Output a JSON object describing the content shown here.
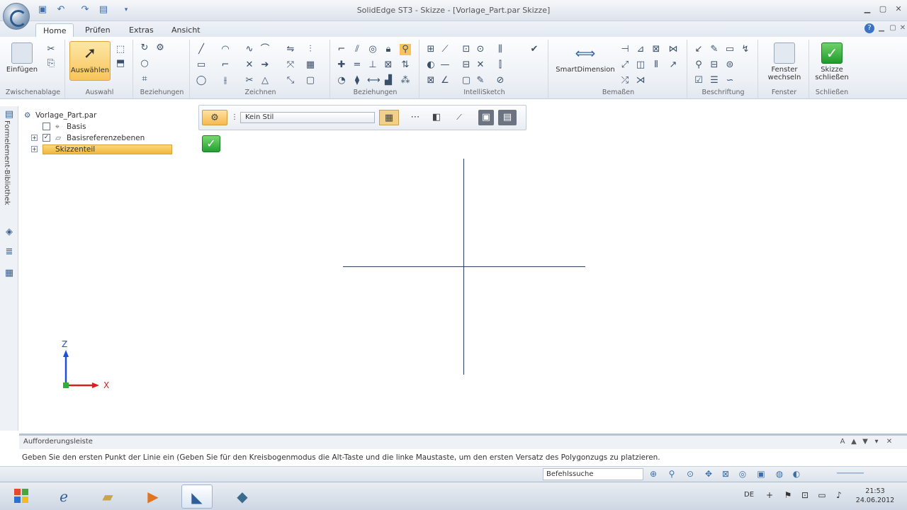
{
  "window": {
    "title": "SolidEdge ST3 - Skizze - [Vorlage_Part.par Skizze]"
  },
  "tabs": [
    {
      "label": "Home"
    },
    {
      "label": "Prüfen"
    },
    {
      "label": "Extras"
    },
    {
      "label": "Ansicht"
    }
  ],
  "ribbon": {
    "clipboard": {
      "paste_label": "Einfügen",
      "group_label": "Zwischenablage"
    },
    "select": {
      "select_label": "Auswählen",
      "group_label": "Auswahl"
    },
    "relate": {
      "group_label": "Beziehungen"
    },
    "draw": {
      "group_label": "Zeichnen"
    },
    "relationships": {
      "group_label": "Beziehungen"
    },
    "intellisketch": {
      "group_label": "IntelliSketch"
    },
    "dimension": {
      "smart_label": "SmartDimension",
      "group_label": "Bemaßen"
    },
    "annotate": {
      "group_label": "Beschriftung"
    },
    "window": {
      "switch_label": "Fenster wechseln",
      "group_label": "Fenster"
    },
    "close": {
      "close_label": "Skizze schließen",
      "group_label": "Schließen"
    }
  },
  "leftbar": {
    "label": "Formelement-Bibliothek"
  },
  "tree": {
    "items": [
      {
        "label": "Vorlage_Part.par"
      },
      {
        "label": "Basis"
      },
      {
        "label": "Basisreferenzebenen"
      },
      {
        "label": "Skizzenteil"
      }
    ]
  },
  "floatbar": {
    "combo_value": "Kein Stil"
  },
  "triad": {
    "z_label": "Z",
    "x_label": "X"
  },
  "command": {
    "title": "Aufforderungsleiste",
    "prompt": "Geben Sie den ersten Punkt der Linie ein (Geben Sie für den Kreisbogenmodus die Alt-Taste und die linke Maustaste, um den ersten Versatz des Polygonzugs zu platzieren."
  },
  "statusbar": {
    "search_placeholder": "Befehlssuche"
  },
  "taskbar": {
    "language": "DE",
    "time": "21:53",
    "date": "24.06.2012"
  },
  "colors": {
    "accent": "#f6b94f",
    "axis": "#2b3f63",
    "z_axis": "#1f4fd6",
    "x_axis": "#d62020",
    "check_green": "#23a030"
  }
}
